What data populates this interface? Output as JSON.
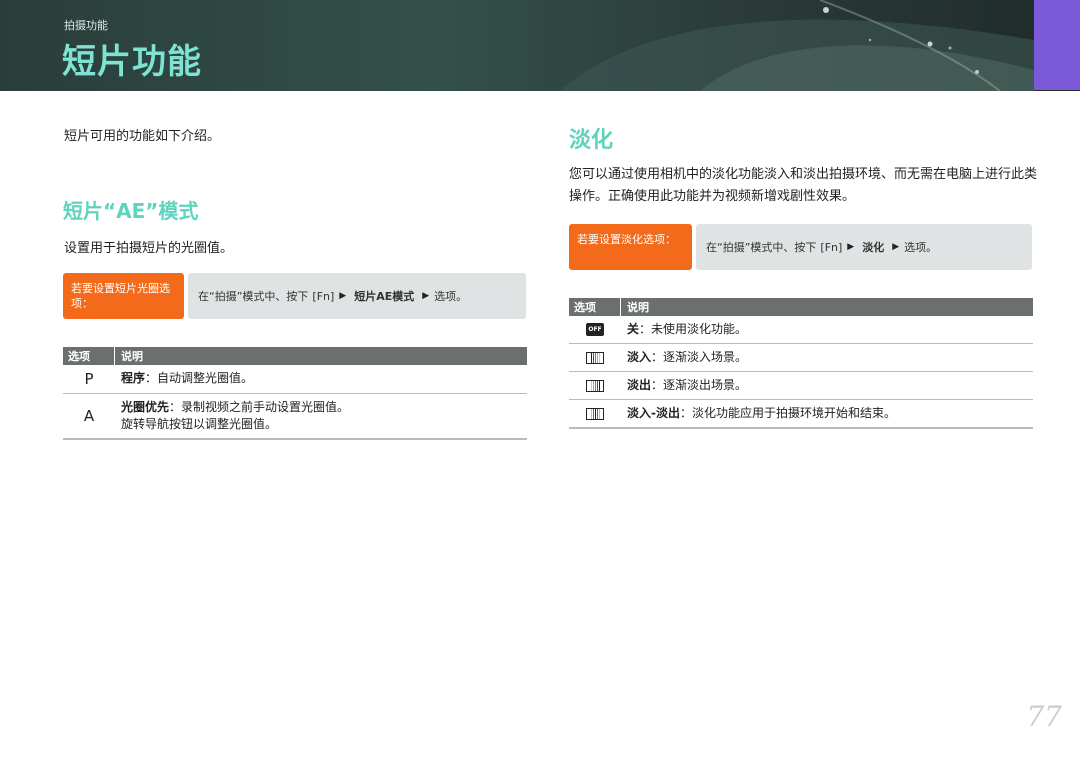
{
  "header": {
    "breadcrumb": "拍摄功能",
    "title": "短片功能"
  },
  "left": {
    "intro": "短片可用的功能如下介绍。",
    "section_title": "短片“AE”模式",
    "desc": "设置用于拍摄短片的光圈值。",
    "howto": {
      "label": "若要设置短片光圈选项：",
      "prefix": "在“拍摄”模式中、按下",
      "key": "[Fn]",
      "menu": "短片AE模式",
      "suffix": "选项。"
    },
    "table": {
      "col1": "选项",
      "col2": "说明",
      "rows": [
        {
          "option": "P",
          "name": "程序",
          "text": "：自动调整光圈值。",
          "text2": ""
        },
        {
          "option": "A",
          "name": "光圈优先",
          "text": "：录制视频之前手动设置光圈值。",
          "text2": "旋转导航按钮以调整光圈值。"
        }
      ]
    }
  },
  "right": {
    "section_title": "淡化",
    "desc": "您可以通过使用相机中的淡化功能淡入和淡出拍摄环境、而无需在电脑上进行此类操作。正确使用此功能并为视频新增戏剧性效果。",
    "howto": {
      "label": "若要设置淡化选项：",
      "prefix": "在“拍摄”模式中、按下",
      "key": "[Fn]",
      "menu": "淡化",
      "suffix": "选项。"
    },
    "table": {
      "col1": "选项",
      "col2": "说明",
      "rows": [
        {
          "icon": "fade-off-icon",
          "icon_text": "OFF",
          "name": "关",
          "text": "：未使用淡化功能。"
        },
        {
          "icon": "fade-in-icon",
          "name": "淡入",
          "text": "：逐渐淡入场景。"
        },
        {
          "icon": "fade-out-icon",
          "name": "淡出",
          "text": "：逐渐淡出场景。"
        },
        {
          "icon": "fade-in-out-icon",
          "name": "淡入-淡出",
          "text": "：淡化功能应用于拍摄环境开始和结束。"
        }
      ]
    }
  },
  "page_number": "77",
  "colors": {
    "accent": "#5ed3bd",
    "orange": "#f46a1b",
    "purple_tab": "#7b5ad9",
    "table_head": "#6b6f70"
  }
}
